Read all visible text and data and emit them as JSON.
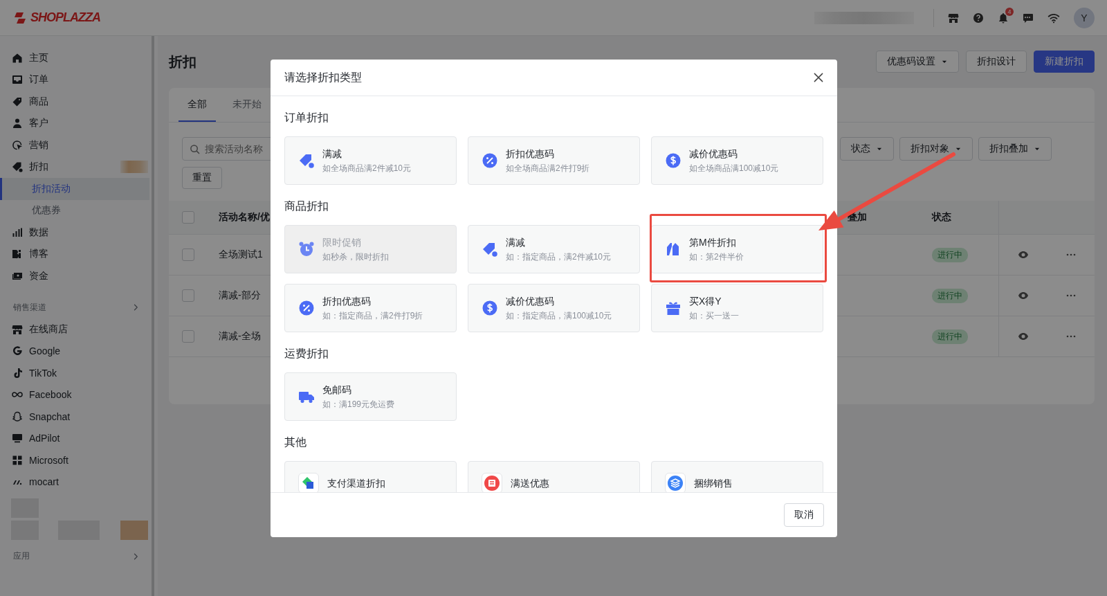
{
  "topbar": {
    "logo": "SHOPLAZZA",
    "notification_count": "4",
    "avatar": "Y"
  },
  "sidebar": {
    "items": [
      {
        "label": "主页",
        "expanded": false
      },
      {
        "label": "订单",
        "expanded": false
      },
      {
        "label": "商品",
        "expanded": false
      },
      {
        "label": "客户",
        "expanded": false
      },
      {
        "label": "营销",
        "expanded": false
      },
      {
        "label": "折扣",
        "expanded": true,
        "children": [
          {
            "label": "折扣活动",
            "selected": true
          },
          {
            "label": "优惠券",
            "selected": false
          }
        ]
      },
      {
        "label": "数据",
        "expanded": false
      },
      {
        "label": "博客",
        "expanded": false
      },
      {
        "label": "资金",
        "expanded": false
      }
    ],
    "channels": {
      "title": "销售渠道",
      "items": [
        "在线商店",
        "Google",
        "TikTok",
        "Facebook",
        "Snapchat",
        "AdPilot",
        "Microsoft",
        "mocart"
      ]
    },
    "apps": {
      "title": "应用"
    }
  },
  "main": {
    "title": "折扣",
    "actions": [
      {
        "label": "优惠码设置",
        "kind": "dropdown"
      },
      {
        "label": "折扣设计",
        "kind": "plain"
      },
      {
        "label": "新建折扣",
        "kind": "primary"
      }
    ],
    "tabs": [
      {
        "label": "全部",
        "selected": true
      },
      {
        "label": "未开始",
        "selected": false
      }
    ],
    "search": {
      "placeholder": "搜索活动名称"
    },
    "reset": "重置",
    "filters": [
      "状态",
      "折扣对象",
      "折扣叠加"
    ],
    "table": {
      "select_all": false,
      "columns": [
        "活动名称/优",
        "叠加",
        "状态"
      ],
      "rows": [
        {
          "checked": false,
          "name": "全场测试1",
          "status": "进行中"
        },
        {
          "checked": false,
          "name": "满减-部分",
          "status": "进行中"
        },
        {
          "checked": false,
          "name": "满减-全场",
          "status": "进行中"
        }
      ]
    }
  },
  "modal": {
    "title": "请选择折扣类型",
    "sections": [
      {
        "title": "订单折扣",
        "options": [
          {
            "kind": "standard",
            "title": "满减",
            "subtitle": "如全场商品满2件减10元",
            "disabled": false,
            "highlighted": false
          },
          {
            "kind": "standard",
            "title": "折扣优惠码",
            "subtitle": "如全场商品满2件打9折",
            "disabled": false,
            "highlighted": false
          },
          {
            "kind": "standard",
            "title": "减价优惠码",
            "subtitle": "如全场商品满100减10元",
            "disabled": false,
            "highlighted": false
          }
        ]
      },
      {
        "title": "商品折扣",
        "options": [
          {
            "kind": "standard",
            "title": "限时促销",
            "subtitle": "如秒杀，限时折扣",
            "disabled": true,
            "highlighted": false
          },
          {
            "kind": "standard",
            "title": "满减",
            "subtitle": "如：指定商品，满2件减10元",
            "disabled": false,
            "highlighted": false
          },
          {
            "kind": "standard",
            "title": "第M件折扣",
            "subtitle": "如：第2件半价",
            "disabled": false,
            "highlighted": true
          },
          {
            "kind": "standard",
            "title": "折扣优惠码",
            "subtitle": "如：指定商品，满2件打9折",
            "disabled": false,
            "highlighted": false
          },
          {
            "kind": "standard",
            "title": "减价优惠码",
            "subtitle": "如：指定商品，满100减10元",
            "disabled": false,
            "highlighted": false
          },
          {
            "kind": "standard",
            "title": "买X得Y",
            "subtitle": "如：买一送一",
            "disabled": false,
            "highlighted": false
          }
        ]
      },
      {
        "title": "运费折扣",
        "options": [
          {
            "kind": "standard",
            "title": "免邮码",
            "subtitle": "如：满199元免运费",
            "disabled": false,
            "highlighted": false
          }
        ]
      },
      {
        "title": "其他",
        "options": [
          {
            "kind": "app",
            "title": "支付渠道折扣",
            "disabled": false,
            "highlighted": false
          },
          {
            "kind": "app",
            "title": "满送优惠",
            "disabled": false,
            "highlighted": false
          },
          {
            "kind": "app",
            "title": "捆绑销售",
            "disabled": false,
            "highlighted": false
          }
        ]
      }
    ],
    "cancel": "取消"
  }
}
